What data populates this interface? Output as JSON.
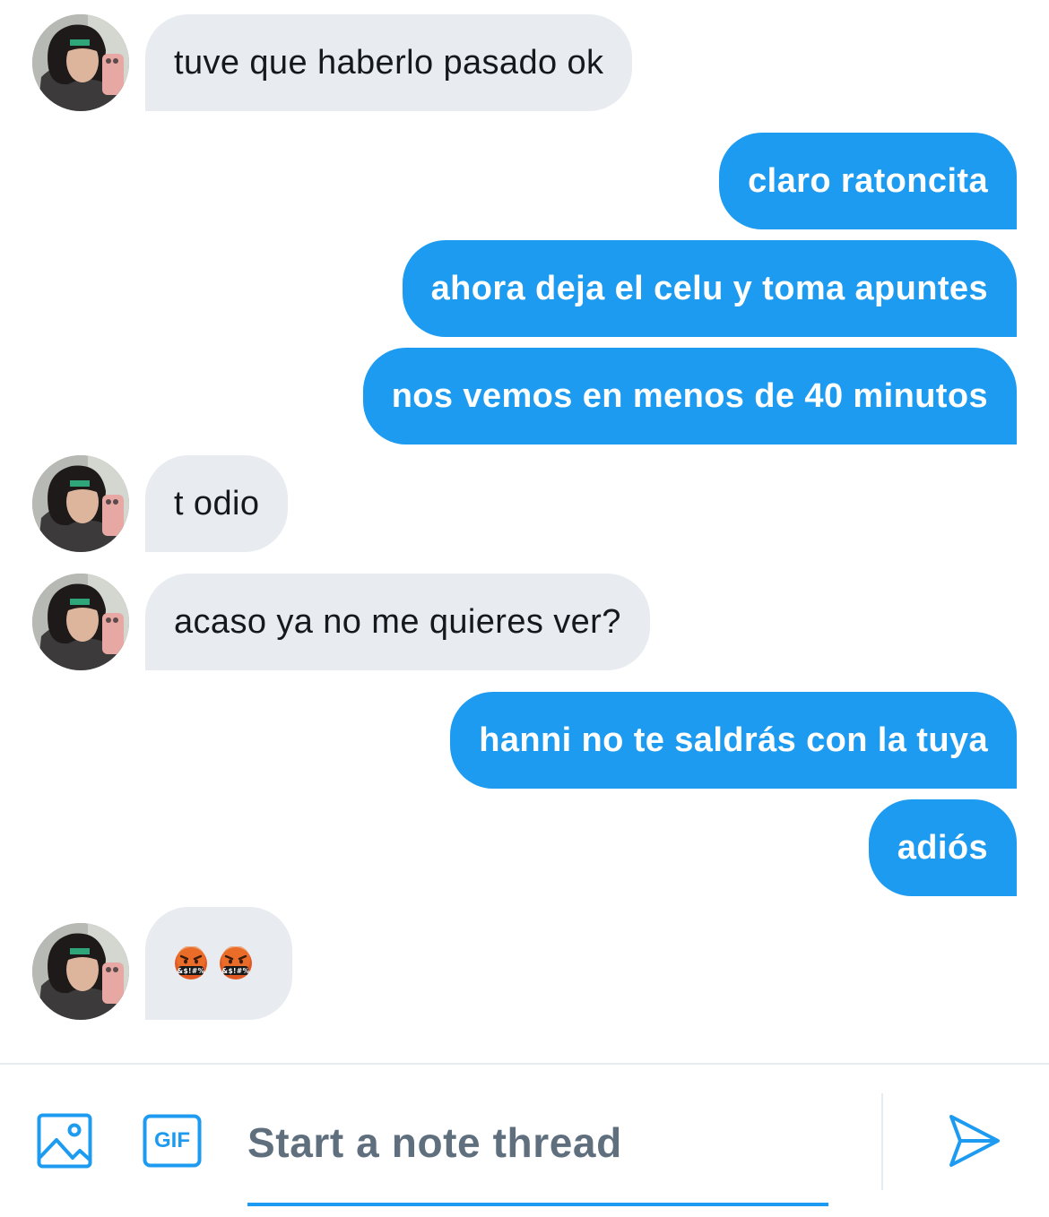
{
  "conversation": {
    "messages": [
      {
        "sender": "them",
        "text": "tuve que haberlo pasado ok"
      },
      {
        "sender": "me",
        "text": "claro ratoncita"
      },
      {
        "sender": "me",
        "text": "ahora deja el celu y toma apuntes"
      },
      {
        "sender": "me",
        "text": "nos vemos en menos de 40 minutos"
      },
      {
        "sender": "them",
        "text": "t odio"
      },
      {
        "sender": "them",
        "text": "acaso ya no me quieres ver?"
      },
      {
        "sender": "me",
        "text": "hanni no te saldrás con la tuya"
      },
      {
        "sender": "me",
        "text": "adiós"
      },
      {
        "sender": "them",
        "emoji": [
          "face-with-symbols-on-mouth",
          "face-with-symbols-on-mouth"
        ],
        "emoji_symbols": "&$!#%"
      }
    ]
  },
  "composer": {
    "placeholder": "Start a note thread",
    "value": "",
    "gif_label": "GIF",
    "icons": {
      "media": "image-icon",
      "gif": "gif-icon",
      "send": "send-icon"
    }
  },
  "colors": {
    "accent": "#1d9bf0",
    "incoming_bubble": "#e8ecf0",
    "incoming_text": "#16191c",
    "outgoing_text": "#ffffff",
    "placeholder": "#5f6f7e"
  }
}
